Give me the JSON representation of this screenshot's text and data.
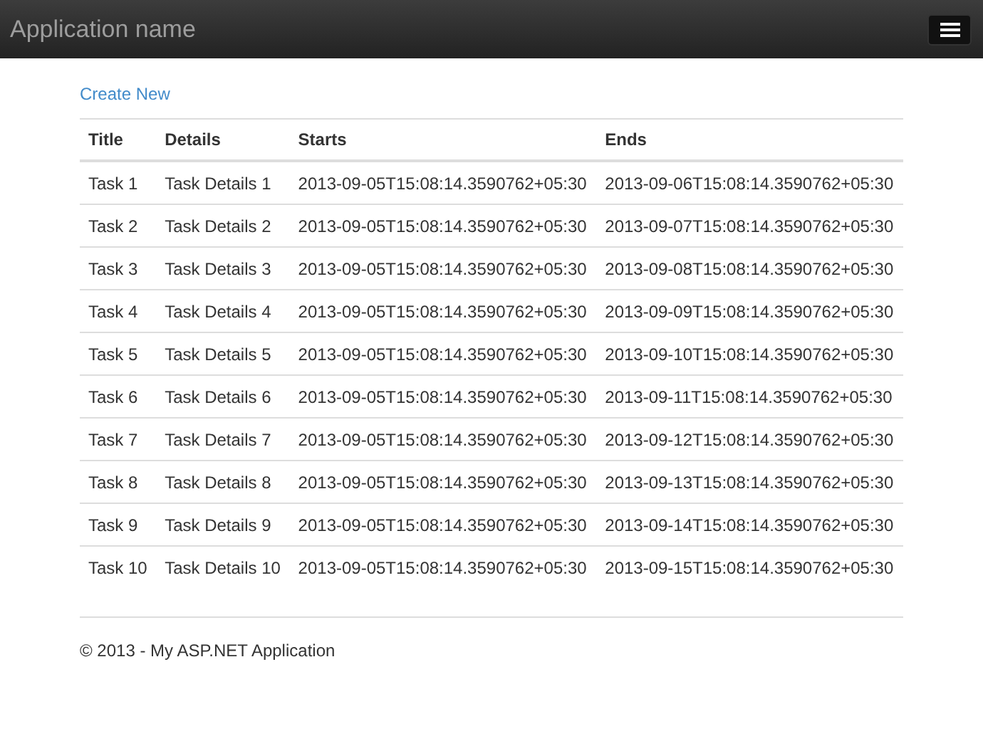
{
  "navbar": {
    "brand": "Application name"
  },
  "create_link": "Create New",
  "table": {
    "columns": [
      "Title",
      "Details",
      "Starts",
      "Ends"
    ],
    "rows": [
      [
        "Task 1",
        "Task Details 1",
        "2013-09-05T15:08:14.3590762+05:30",
        "2013-09-06T15:08:14.3590762+05:30"
      ],
      [
        "Task 2",
        "Task Details 2",
        "2013-09-05T15:08:14.3590762+05:30",
        "2013-09-07T15:08:14.3590762+05:30"
      ],
      [
        "Task 3",
        "Task Details 3",
        "2013-09-05T15:08:14.3590762+05:30",
        "2013-09-08T15:08:14.3590762+05:30"
      ],
      [
        "Task 4",
        "Task Details 4",
        "2013-09-05T15:08:14.3590762+05:30",
        "2013-09-09T15:08:14.3590762+05:30"
      ],
      [
        "Task 5",
        "Task Details 5",
        "2013-09-05T15:08:14.3590762+05:30",
        "2013-09-10T15:08:14.3590762+05:30"
      ],
      [
        "Task 6",
        "Task Details 6",
        "2013-09-05T15:08:14.3590762+05:30",
        "2013-09-11T15:08:14.3590762+05:30"
      ],
      [
        "Task 7",
        "Task Details 7",
        "2013-09-05T15:08:14.3590762+05:30",
        "2013-09-12T15:08:14.3590762+05:30"
      ],
      [
        "Task 8",
        "Task Details 8",
        "2013-09-05T15:08:14.3590762+05:30",
        "2013-09-13T15:08:14.3590762+05:30"
      ],
      [
        "Task 9",
        "Task Details 9",
        "2013-09-05T15:08:14.3590762+05:30",
        "2013-09-14T15:08:14.3590762+05:30"
      ],
      [
        "Task 10",
        "Task Details 10",
        "2013-09-05T15:08:14.3590762+05:30",
        "2013-09-15T15:08:14.3590762+05:30"
      ]
    ]
  },
  "footer": "© 2013 - My ASP.NET Application"
}
